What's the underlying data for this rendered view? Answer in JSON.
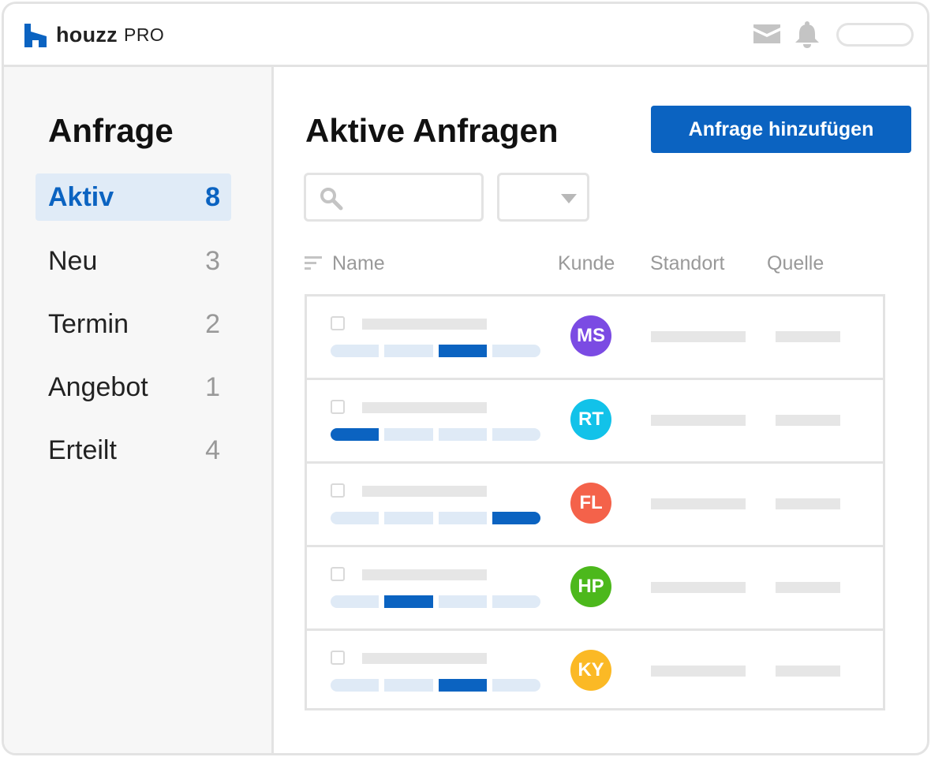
{
  "brand": {
    "name": "houzz",
    "suffix": "PRO",
    "color": "#0b63c1"
  },
  "topbar": {
    "icons": [
      "mail-icon",
      "bell-icon"
    ]
  },
  "sidebar": {
    "title": "Anfrage",
    "items": [
      {
        "label": "Aktiv",
        "count": "8",
        "active": true
      },
      {
        "label": "Neu",
        "count": "3"
      },
      {
        "label": "Termin",
        "count": "2"
      },
      {
        "label": "Angebot",
        "count": "1"
      },
      {
        "label": "Erteilt",
        "count": "4"
      }
    ]
  },
  "main": {
    "title": "Aktive Anfragen",
    "add_button": "Anfrage hinzufügen",
    "search": {
      "value": ""
    },
    "filter": {
      "value": ""
    },
    "columns": {
      "name": "Name",
      "client": "Kunde",
      "location": "Standort",
      "source": "Quelle"
    },
    "rows": [
      {
        "initials": "MS",
        "avatar_color": "#7b4be3",
        "stage": 3,
        "stages_total": 4
      },
      {
        "initials": "RT",
        "avatar_color": "#12c2e9",
        "stage": 1,
        "stages_total": 4
      },
      {
        "initials": "FL",
        "avatar_color": "#f4624a",
        "stage": 4,
        "stages_total": 4
      },
      {
        "initials": "HP",
        "avatar_color": "#4cb81c",
        "stage": 2,
        "stages_total": 4
      },
      {
        "initials": "KY",
        "avatar_color": "#fbb925",
        "stage": 3,
        "stages_total": 4
      }
    ]
  }
}
